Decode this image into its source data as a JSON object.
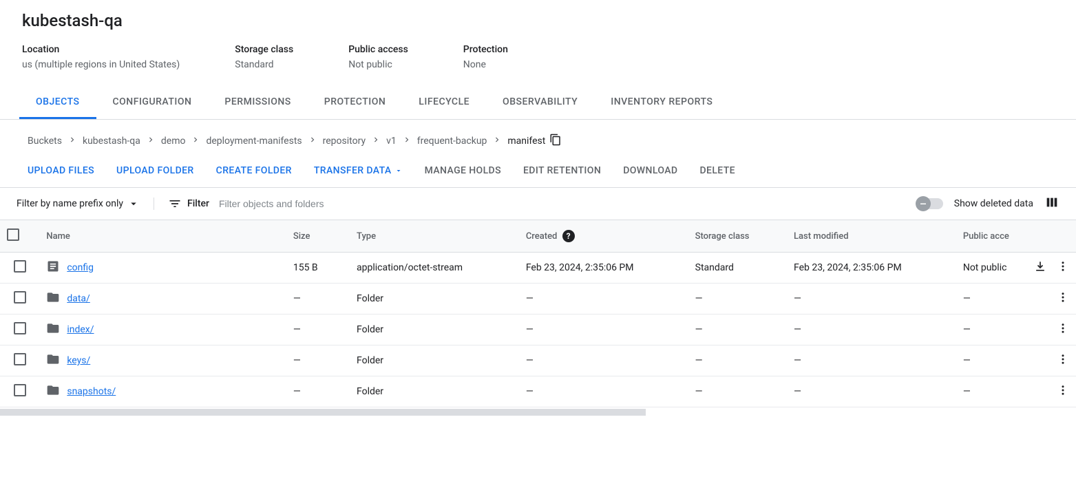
{
  "title": "kubestash-qa",
  "meta": {
    "location_label": "Location",
    "location_value": "us (multiple regions in United States)",
    "storage_label": "Storage class",
    "storage_value": "Standard",
    "public_label": "Public access",
    "public_value": "Not public",
    "protection_label": "Protection",
    "protection_value": "None"
  },
  "tabs": {
    "objects": "OBJECTS",
    "configuration": "CONFIGURATION",
    "permissions": "PERMISSIONS",
    "protection": "PROTECTION",
    "lifecycle": "LIFECYCLE",
    "observability": "OBSERVABILITY",
    "inventory": "INVENTORY REPORTS"
  },
  "breadcrumb": {
    "items": [
      "Buckets",
      "kubestash-qa",
      "demo",
      "deployment-manifests",
      "repository",
      "v1",
      "frequent-backup"
    ],
    "current": "manifest"
  },
  "actions": {
    "upload_files": "UPLOAD FILES",
    "upload_folder": "UPLOAD FOLDER",
    "create_folder": "CREATE FOLDER",
    "transfer_data": "TRANSFER DATA",
    "manage_holds": "MANAGE HOLDS",
    "edit_retention": "EDIT RETENTION",
    "download": "DOWNLOAD",
    "delete": "DELETE"
  },
  "filter": {
    "prefix_label": "Filter by name prefix only",
    "filter_label": "Filter",
    "placeholder": "Filter objects and folders",
    "toggle_label": "Show deleted data"
  },
  "columns": {
    "name": "Name",
    "size": "Size",
    "type": "Type",
    "created": "Created",
    "storage": "Storage class",
    "modified": "Last modified",
    "public": "Public acce"
  },
  "rows": [
    {
      "icon": "file",
      "name": "config",
      "size": "155 B",
      "type": "application/octet-stream",
      "created": "Feb 23, 2024, 2:35:06 PM",
      "storage": "Standard",
      "modified": "Feb 23, 2024, 2:35:06 PM",
      "public": "Not public",
      "download": true
    },
    {
      "icon": "folder",
      "name": "data/",
      "size": "—",
      "type": "Folder",
      "created": "—",
      "storage": "—",
      "modified": "—",
      "public": "—",
      "download": false
    },
    {
      "icon": "folder",
      "name": "index/",
      "size": "—",
      "type": "Folder",
      "created": "—",
      "storage": "—",
      "modified": "—",
      "public": "—",
      "download": false
    },
    {
      "icon": "folder",
      "name": "keys/",
      "size": "—",
      "type": "Folder",
      "created": "—",
      "storage": "—",
      "modified": "—",
      "public": "—",
      "download": false
    },
    {
      "icon": "folder",
      "name": "snapshots/",
      "size": "—",
      "type": "Folder",
      "created": "—",
      "storage": "—",
      "modified": "—",
      "public": "—",
      "download": false
    }
  ]
}
